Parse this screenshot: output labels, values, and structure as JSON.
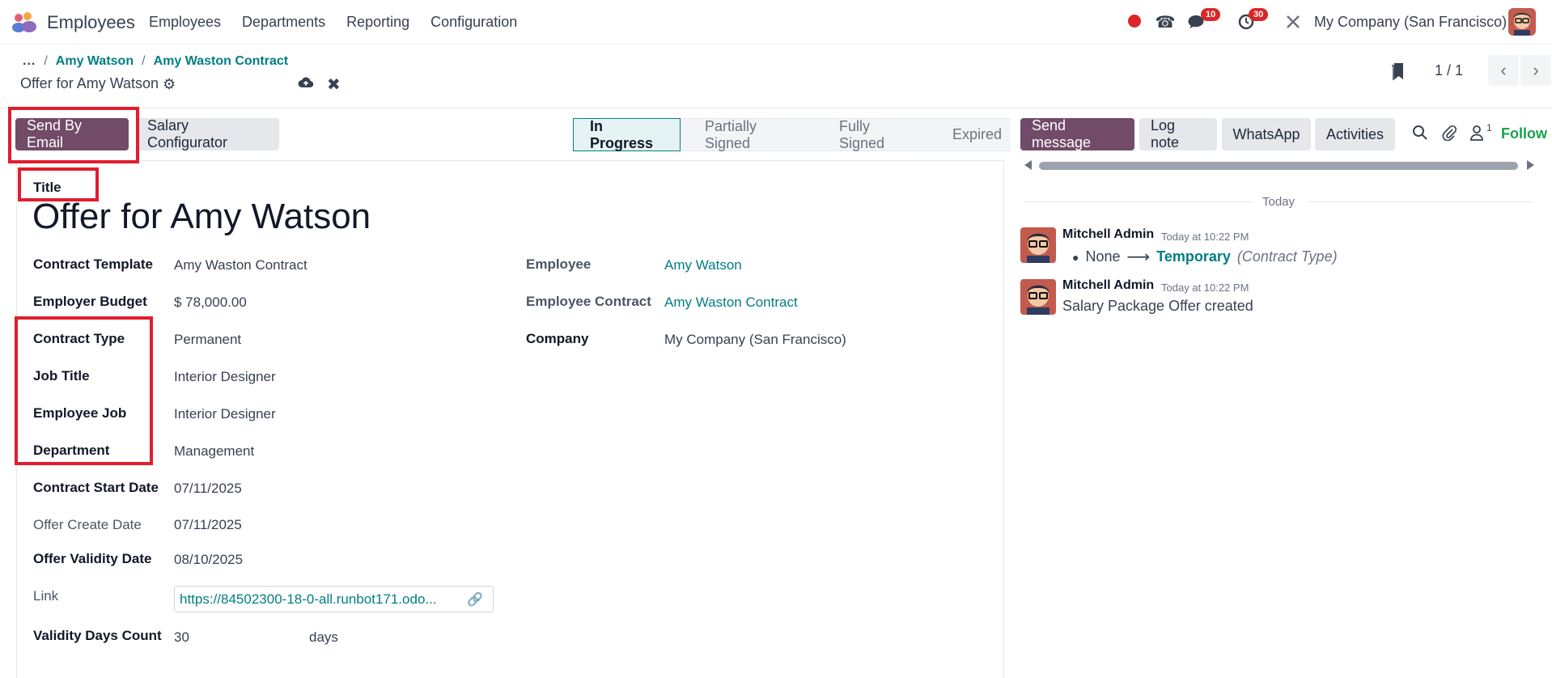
{
  "navbar": {
    "app_name": "Employees",
    "menu": [
      "Employees",
      "Departments",
      "Reporting",
      "Configuration"
    ],
    "messages_badge": "10",
    "activities_badge": "30",
    "company": "My Company (San Francisco)"
  },
  "breadcrumb": {
    "ellipsis": "...",
    "items": [
      "Amy Watson",
      "Amy Waston Contract"
    ],
    "separator": "/",
    "current": "Offer for Amy Watson"
  },
  "pager": {
    "value": "1 / 1"
  },
  "buttons": {
    "send_by_email": "Send By Email",
    "salary_configurator": "Salary Configurator"
  },
  "statusbar": {
    "stages": [
      "In Progress",
      "Partially Signed",
      "Fully Signed",
      "Expired"
    ],
    "active": "In Progress"
  },
  "form": {
    "title_label": "Title",
    "title_value": "Offer for Amy Watson",
    "left": [
      {
        "label": "Contract Template",
        "value": "Amy Waston Contract"
      },
      {
        "label": "Employer Budget",
        "value": "$ 78,000.00"
      },
      {
        "label": "Contract Type",
        "value": "Permanent"
      },
      {
        "label": "Job Title",
        "value": "Interior Designer"
      },
      {
        "label": "Employee Job",
        "value": "Interior Designer"
      },
      {
        "label": "Department",
        "value": "Management"
      },
      {
        "label": "Contract Start Date",
        "value": "07/11/2025"
      },
      {
        "label": "Offer Create Date",
        "value": "07/11/2025"
      },
      {
        "label": "Offer Validity Date",
        "value": "08/10/2025"
      },
      {
        "label": "Link",
        "value": "https://84502300-18-0-all.runbot171.odo..."
      },
      {
        "label": "Validity Days Count",
        "value": "30",
        "suffix": "days"
      }
    ],
    "right": [
      {
        "label": "Employee",
        "value": "Amy Watson"
      },
      {
        "label": "Employee Contract",
        "value": "Amy Waston Contract"
      },
      {
        "label": "Company",
        "value": "My Company (San Francisco)"
      }
    ]
  },
  "chatter": {
    "send_message": "Send message",
    "log_note": "Log note",
    "whatsapp": "WhatsApp",
    "activities": "Activities",
    "followers_count": "1",
    "follow": "Follow",
    "date_separator": "Today",
    "messages": [
      {
        "author": "Mitchell Admin",
        "date": "Today at 10:22 PM",
        "old": "None",
        "new": "Temporary",
        "field": "(Contract Type)"
      },
      {
        "author": "Mitchell Admin",
        "date": "Today at 10:22 PM",
        "body": "Salary Package Offer created"
      }
    ]
  },
  "colors": {
    "brand": "#714b67",
    "link": "#017e84",
    "annotation": "#e11d2e",
    "badge": "#dc2626"
  }
}
